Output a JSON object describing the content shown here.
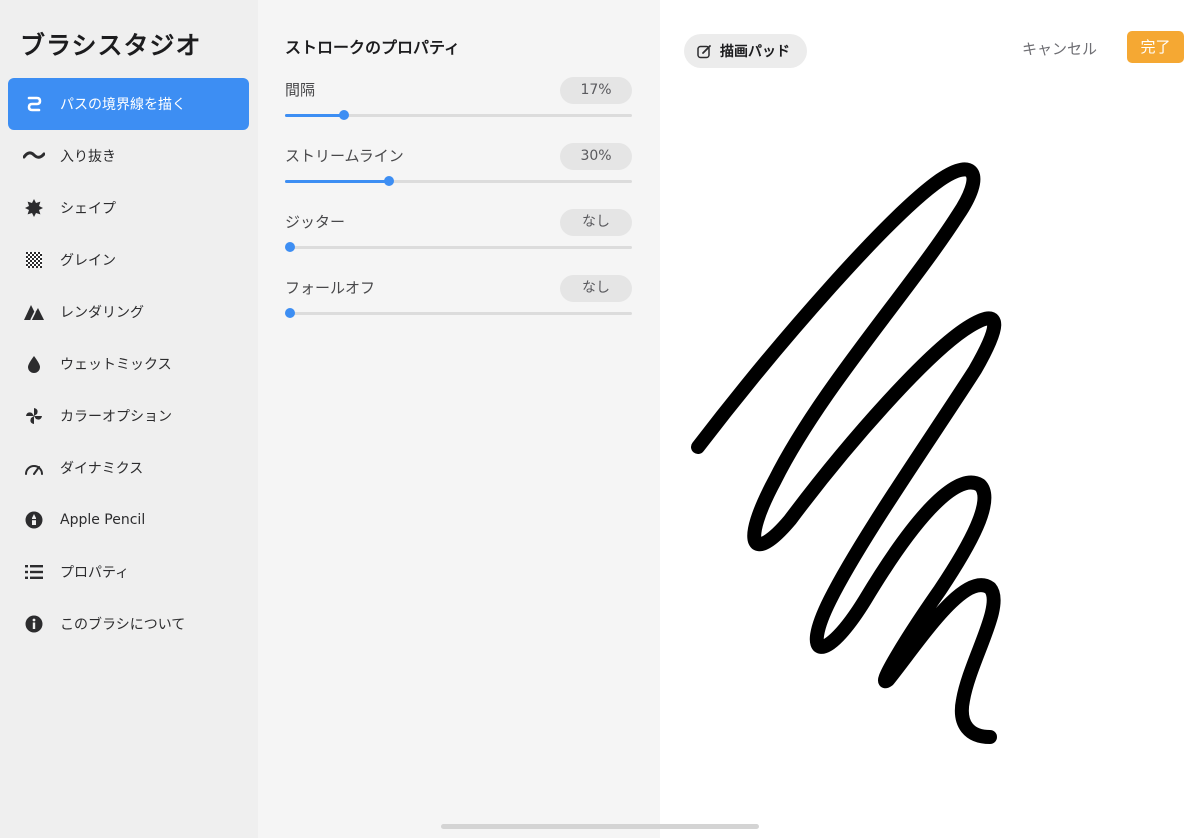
{
  "sidebar": {
    "title": "ブラシスタジオ",
    "items": [
      {
        "label": "パスの境界線を描く",
        "icon": "stroke-path-icon",
        "active": true
      },
      {
        "label": "入り抜き",
        "icon": "taper-icon",
        "active": false
      },
      {
        "label": "シェイプ",
        "icon": "shape-icon",
        "active": false
      },
      {
        "label": "グレイン",
        "icon": "grain-icon",
        "active": false
      },
      {
        "label": "レンダリング",
        "icon": "rendering-icon",
        "active": false
      },
      {
        "label": "ウェットミックス",
        "icon": "wet-mix-icon",
        "active": false
      },
      {
        "label": "カラーオプション",
        "icon": "color-options-icon",
        "active": false
      },
      {
        "label": "ダイナミクス",
        "icon": "dynamics-icon",
        "active": false
      },
      {
        "label": "Apple Pencil",
        "icon": "apple-pencil-icon",
        "active": false
      },
      {
        "label": "プロパティ",
        "icon": "properties-icon",
        "active": false
      },
      {
        "label": "このブラシについて",
        "icon": "about-icon",
        "active": false
      }
    ]
  },
  "panel": {
    "title": "ストロークのプロパティ",
    "properties": [
      {
        "label": "間隔",
        "value": "17%",
        "level": 0.17
      },
      {
        "label": "ストリームライン",
        "value": "30%",
        "level": 0.3
      },
      {
        "label": "ジッター",
        "value": "なし",
        "level": 0
      },
      {
        "label": "フォールオフ",
        "value": "なし",
        "level": 0
      }
    ]
  },
  "pad": {
    "drawing_pad_label": "描画パッド",
    "cancel_label": "キャンセル",
    "done_label": "完了"
  },
  "colors": {
    "accent": "#3d8ef3",
    "done": "#f5a833",
    "sidebar_bg": "#efefef",
    "panel_bg": "#f5f5f5"
  }
}
